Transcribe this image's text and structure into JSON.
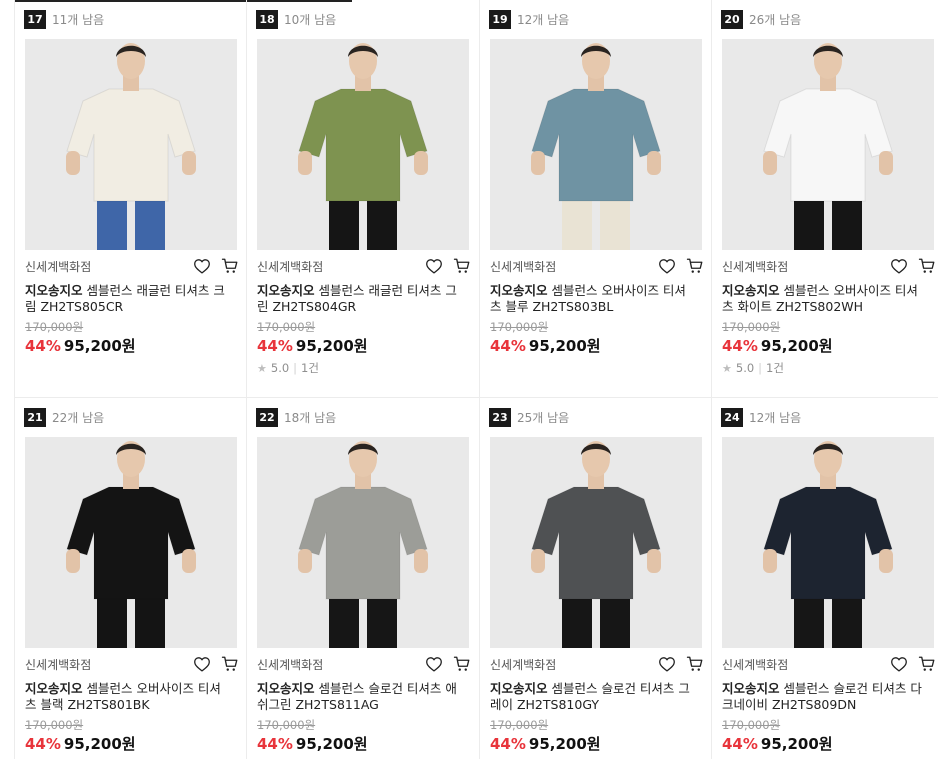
{
  "colors": {
    "discount": "#e8343b",
    "rank_badge": "#1a1a1a"
  },
  "icons": {
    "wishlist": "heart-icon",
    "cart": "cart-icon",
    "rating": "star-icon"
  },
  "products": [
    {
      "rank": "17",
      "stock": "11개 남음",
      "store": "신세계백화점",
      "brand": "지오송지오",
      "name": " 셈블런스 래글런 티셔츠 크림 ZH2TS805CR",
      "original_price": "170,000원",
      "discount": "44%",
      "price": "95,200원",
      "rating": "",
      "reviews": "",
      "shirt_color": "#f1ede3",
      "pants_color": "#3f66a8"
    },
    {
      "rank": "18",
      "stock": "10개 남음",
      "store": "신세계백화점",
      "brand": "지오송지오",
      "name": " 셈블런스 래글런 티셔츠 그린 ZH2TS804GR",
      "original_price": "170,000원",
      "discount": "44%",
      "price": "95,200원",
      "rating": "5.0",
      "reviews": "1건",
      "shirt_color": "#7e9350",
      "pants_color": "#151515"
    },
    {
      "rank": "19",
      "stock": "12개 남음",
      "store": "신세계백화점",
      "brand": "지오송지오",
      "name": " 셈블런스 오버사이즈 티셔츠 블루 ZH2TS803BL",
      "original_price": "170,000원",
      "discount": "44%",
      "price": "95,200원",
      "rating": "",
      "reviews": "",
      "shirt_color": "#6f93a3",
      "pants_color": "#e9e3d4"
    },
    {
      "rank": "20",
      "stock": "26개 남음",
      "store": "신세계백화점",
      "brand": "지오송지오",
      "name": " 셈블런스 오버사이즈 티셔츠 화이트 ZH2TS802WH",
      "original_price": "170,000원",
      "discount": "44%",
      "price": "95,200원",
      "rating": "5.0",
      "reviews": "1건",
      "shirt_color": "#f7f7f7",
      "pants_color": "#151515"
    },
    {
      "rank": "21",
      "stock": "22개 남음",
      "store": "신세계백화점",
      "brand": "지오송지오",
      "name": " 셈블런스 오버사이즈 티셔츠 블랙 ZH2TS801BK",
      "original_price": "170,000원",
      "discount": "44%",
      "price": "95,200원",
      "rating": "",
      "reviews": "",
      "shirt_color": "#141414",
      "pants_color": "#141414"
    },
    {
      "rank": "22",
      "stock": "18개 남음",
      "store": "신세계백화점",
      "brand": "지오송지오",
      "name": " 셈블런스 슬로건 티셔츠 애쉬그린 ZH2TS811AG",
      "original_price": "170,000원",
      "discount": "44%",
      "price": "95,200원",
      "rating": "",
      "reviews": "",
      "shirt_color": "#9c9d98",
      "pants_color": "#161616"
    },
    {
      "rank": "23",
      "stock": "25개 남음",
      "store": "신세계백화점",
      "brand": "지오송지오",
      "name": " 셈블런스 슬로건 티셔츠 그레이 ZH2TS810GY",
      "original_price": "170,000원",
      "discount": "44%",
      "price": "95,200원",
      "rating": "",
      "reviews": "",
      "shirt_color": "#4f5153",
      "pants_color": "#161616"
    },
    {
      "rank": "24",
      "stock": "12개 남음",
      "store": "신세계백화점",
      "brand": "지오송지오",
      "name": " 셈블런스 슬로건 티셔츠 다크네이비 ZH2TS809DN",
      "original_price": "170,000원",
      "discount": "44%",
      "price": "95,200원",
      "rating": "",
      "reviews": "",
      "shirt_color": "#1d2430",
      "pants_color": "#161616"
    }
  ]
}
